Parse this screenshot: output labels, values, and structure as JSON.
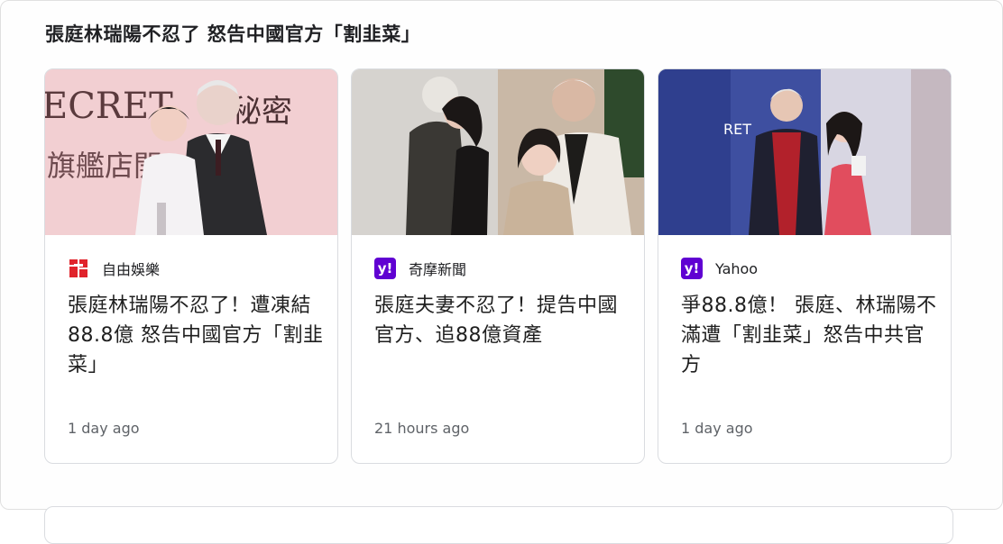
{
  "section": {
    "title": "張庭林瑞陽不忍了 怒告中國官方「割韭菜」"
  },
  "cards": [
    {
      "source": "自由娛樂",
      "headline": "張庭林瑞陽不忍了！遭凍結88.8億 怒告中國官方「割韭菜」",
      "time": "1 day ago",
      "logo_icon": "ltn-logo-icon"
    },
    {
      "source": "奇摩新聞",
      "headline": "張庭夫妻不忍了！提告中國官方、追88億資產",
      "time": "21 hours ago",
      "logo_icon": "yahoo-logo-icon"
    },
    {
      "source": "Yahoo",
      "headline": "爭88.8億！ 張庭、林瑞陽不滿遭「割韭菜」怒告中共官方",
      "time": "1 day ago",
      "logo_icon": "yahoo-logo-icon"
    }
  ],
  "thumb_text": {
    "secret_left": "ECRET",
    "secret_cn": "秘密",
    "banner_cn": "旗艦店開",
    "secret_right": "RET"
  },
  "colors": {
    "yahoo_purple": "#6001d2",
    "ltn_red": "#e0232b"
  }
}
